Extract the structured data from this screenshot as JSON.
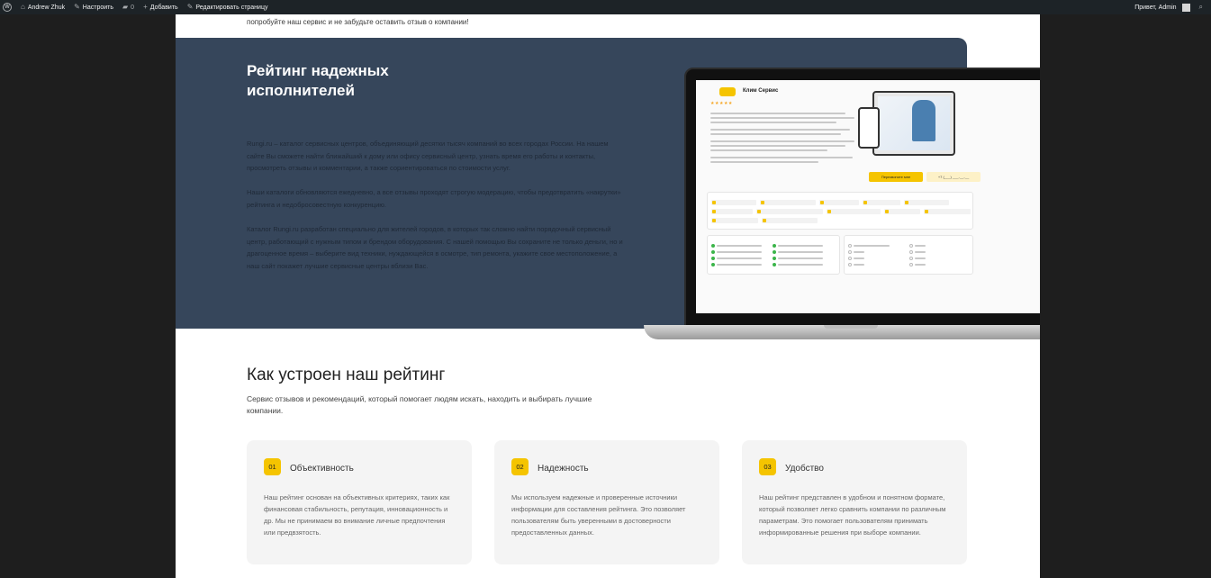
{
  "adminbar": {
    "site_name": "Andrew Zhuk",
    "customize": "Настроить",
    "comments_count": "0",
    "add_new": "Добавить",
    "edit_page": "Редактировать страницу",
    "greeting": "Привет, Admin"
  },
  "intro_text": "попробуйте наш сервис и не забудьте оставить отзыв о компании!",
  "banner": {
    "title": "Рейтинг надежных исполнителей",
    "p1": "Rungi.ru – каталог сервисных центров, объединяющий десятки тысяч компаний во всех городах России. На нашем сайте Вы сможете найти ближайший к дому или офису сервисный центр, узнать время его работы и контакты, просмотреть отзывы и комментарии, а также сориентироваться по стоимости услуг.",
    "p2": "Наши каталоги обновляются ежедневно, а все отзывы проходят строгую модерацию, чтобы предотвратить «накрутки» рейтинга и недобросовестную конкуренцию.",
    "p3": "Каталог Rungi.ru разработан специально для жителей городов, в которых так сложно найти порядочный сервисный центр, работающий с нужным типом и брендом оборудования. С нашей помощью Вы сохраните не только деньги, но и драгоценное время – выберите вид техники, нуждающейся в осмотре, тип ремонта, укажите свое местоположение, а наш сайт покажет лучшие сервисные центры вблизи Вас."
  },
  "laptop_screen": {
    "company": "Клим Сервис",
    "stars": "★★★★★",
    "call_button": "Перезвоните мне",
    "phone_button": "+7 (___) ___-__-__"
  },
  "section2": {
    "title": "Как устроен наш рейтинг",
    "subtitle": "Сервис отзывов и рекомендаций, который помогает людям искать, находить и выбирать лучшие компании."
  },
  "cards": [
    {
      "num": "01",
      "title": "Объективность",
      "text": "Наш рейтинг основан на объективных критериях, таких как финансовая стабильность, репутация, инновационность и др. Мы не принимаем во внимание личные предпочтения или предвзятость."
    },
    {
      "num": "02",
      "title": "Надежность",
      "text": "Мы используем надежные и проверенные источники информации для составления рейтинга. Это позволяет пользователям быть уверенными в достоверности предоставленных данных."
    },
    {
      "num": "03",
      "title": "Удобство",
      "text": "Наш рейтинг представлен в удобном и понятном формате, который позволяет легко сравнить компании по различным параметрам. Это помогает пользователям принимать информированные решения при выборе компании."
    }
  ]
}
